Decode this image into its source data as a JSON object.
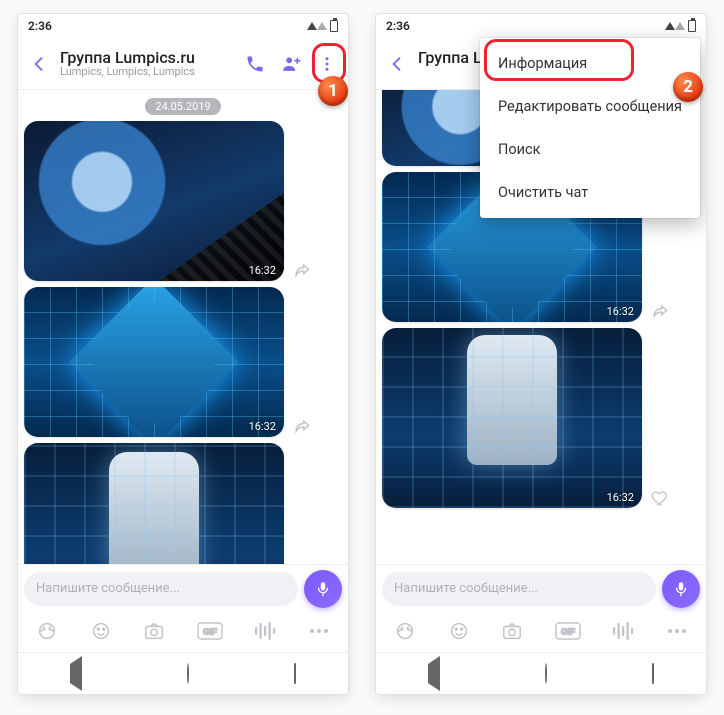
{
  "status": {
    "time": "2:36"
  },
  "header": {
    "title": "Группа Lumpics.ru",
    "subtitle": "Lumpics, Lumpics, Lumpics"
  },
  "chat": {
    "date_chip": "24.05.2019",
    "messages": [
      {
        "time": "16:32"
      },
      {
        "time": "16:32"
      },
      {
        "time": "16:32"
      }
    ]
  },
  "composer": {
    "placeholder": "Напишите сообщение..."
  },
  "menu": {
    "items": [
      "Информация",
      "Редактировать сообщения",
      "Поиск",
      "Очистить чат"
    ]
  },
  "callouts": {
    "one": "1",
    "two": "2"
  },
  "right_header_title_clip": "Группа Lu"
}
